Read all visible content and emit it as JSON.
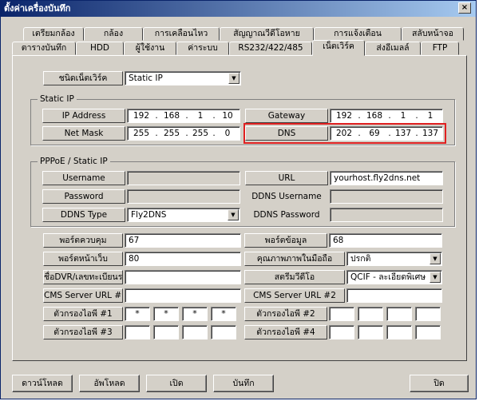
{
  "window": {
    "title": "ตั้งค่าเครื่องบันทึก",
    "close": "×"
  },
  "tabs_top": [
    "เตรียมกล้อง",
    "กล้อง",
    "การเคลื่อนไหว",
    "สัญญาณวีดีโอหาย",
    "การแจ้งเตือน",
    "สลับหน้าจอ"
  ],
  "tabs_bottom": [
    "ตารางบันทึก",
    "HDD",
    "ผู้ใช้งาน",
    "ค่าระบบ",
    "RS232/422/485",
    "เน็ตเวิร์ค",
    "ส่งอีเมลล์",
    "FTP"
  ],
  "active_tab": "เน็ตเวิร์ค",
  "network_type": {
    "label": "ชนิดเน็ตเวิร์ค",
    "value": "Static IP"
  },
  "static_ip": {
    "title": "Static IP",
    "ip_label": "IP Address",
    "ip": [
      "192",
      "168",
      "1",
      "10"
    ],
    "gateway_label": "Gateway",
    "gateway": [
      "192",
      "168",
      "1",
      "1"
    ],
    "mask_label": "Net Mask",
    "mask": [
      "255",
      "255",
      "255",
      "0"
    ],
    "dns_label": "DNS",
    "dns": [
      "202",
      "69",
      "137",
      "137"
    ]
  },
  "pppoe": {
    "title": "PPPoE / Static IP",
    "username_label": "Username",
    "password_label": "Password",
    "ddns_type_label": "DDNS Type",
    "ddns_type": "Fly2DNS",
    "url_label": "URL",
    "url": "yourhost.fly2dns.net",
    "ddns_username_label": "DDNS Username",
    "ddns_password_label": "DDNS Password"
  },
  "ports": {
    "control_label": "พอร์ตควบคุม",
    "control": "67",
    "data_label": "พอร์ตข้อมูล",
    "data": "68",
    "web_label": "พอร์ตหน้าเว็บ",
    "web": "80",
    "mobile_label": "คุณภาพภาพในมือถือ",
    "mobile": "ปรกติ",
    "dvr_label": "ชื่อDVR/เลขทะเบียนรถ",
    "stream_label": "สตรีมวีดีโอ",
    "stream": "QCIF - ละเอียดพิเศษ",
    "cms1_label": "CMS Server URL #1",
    "cms2_label": "CMS Server URL #2",
    "filter1_label": "ตัวกรองไอพี #1",
    "filter1": [
      "*",
      "*",
      "*",
      "*"
    ],
    "filter2_label": "ตัวกรองไอพี #2",
    "filter3_label": "ตัวกรองไอพี #3",
    "filter4_label": "ตัวกรองไอพี #4"
  },
  "buttons": {
    "download": "ดาวน์โหลด",
    "upload": "อัพโหลด",
    "open": "เปิด",
    "save": "บันทึก",
    "close": "ปิด"
  },
  "colors": {
    "face": "#d4d0c8",
    "title": "#0a246a",
    "highlight": "#e02020"
  }
}
